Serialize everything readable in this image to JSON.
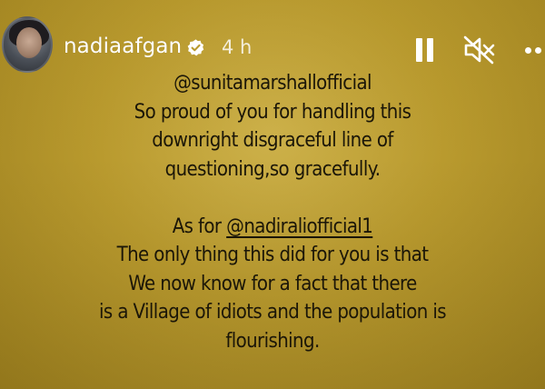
{
  "story": {
    "username": "nadiaafgan",
    "time": "4 h",
    "verified": true,
    "colors": {
      "background": "#b99a2e",
      "text": "#1b1608",
      "header_text": "#ffffff"
    }
  },
  "controls": {
    "pause_icon": "pause-icon",
    "mute_icon": "muted-speaker-icon",
    "more_icon": "more-options-icon"
  },
  "message": {
    "mention_1": "@sunitamarshallofficial",
    "line_1": "So proud of you for handling this",
    "line_2": "downright disgraceful line of",
    "line_3": "questioning,so gracefully.",
    "as_for": "As for ",
    "mention_2": "@nadiraliofficial1",
    "line_4": "The only thing this did for you is that",
    "line_5": "We now know  for a fact that there",
    "line_6": "is a Village of idiots and the population is",
    "line_7": "flourishing."
  }
}
